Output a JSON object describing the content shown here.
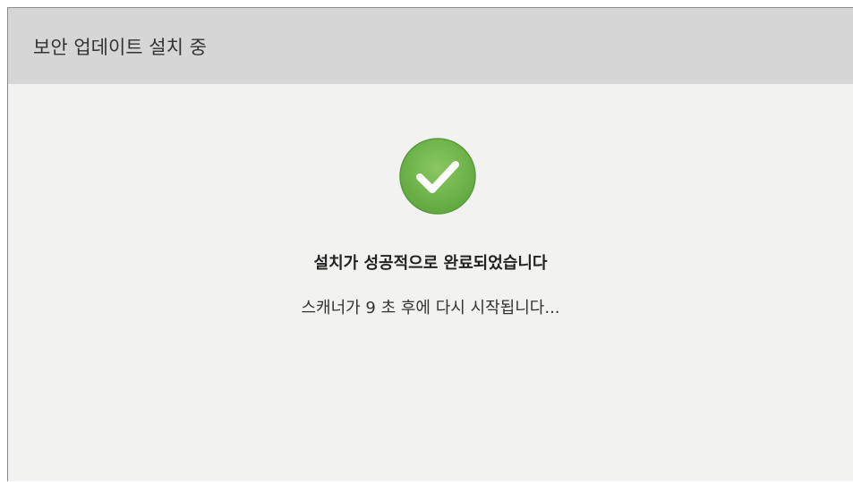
{
  "dialog": {
    "title": "보안 업데이트 설치 중",
    "status_icon": "check-circle-icon",
    "status_color": "#6ab04c",
    "success_message": "설치가 성공적으로 완료되었습니다",
    "restart_message": "스캐너가 9 초 후에 다시 시작됩니다..."
  }
}
